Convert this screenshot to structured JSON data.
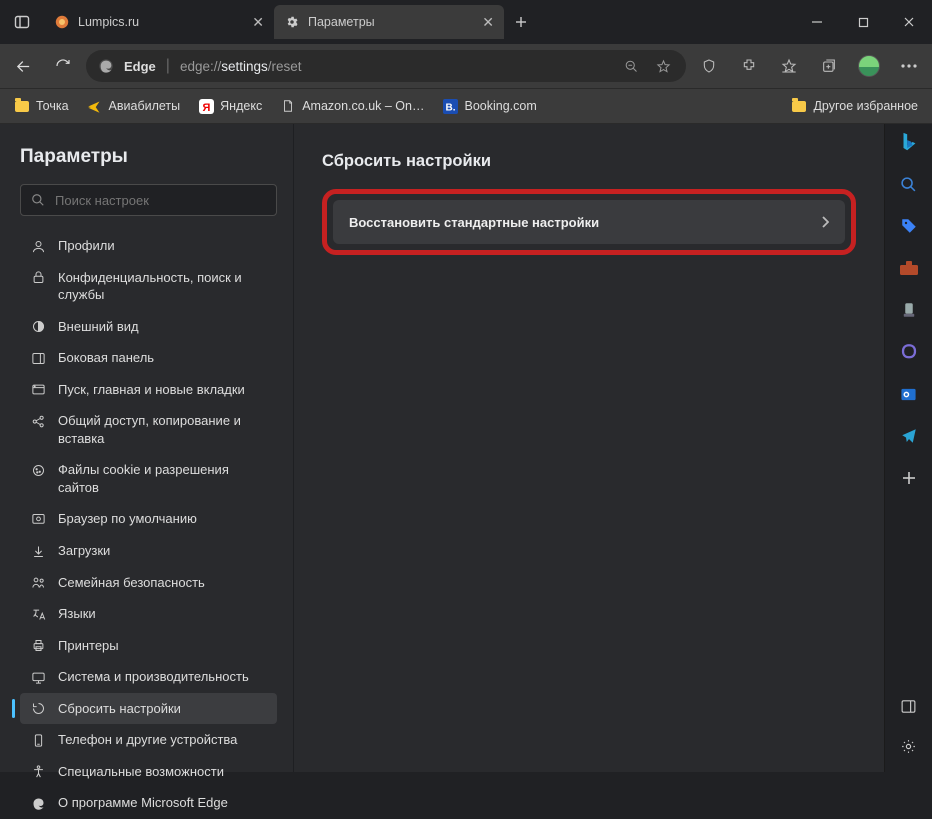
{
  "tabs": [
    {
      "title": "Lumpics.ru",
      "favicon": "circle-orange"
    },
    {
      "title": "Параметры",
      "favicon": "gear"
    }
  ],
  "address": {
    "browser_label": "Edge",
    "url_prefix": "edge://",
    "url_segment": "settings",
    "url_rest": "/reset"
  },
  "bookmarks": {
    "items": [
      {
        "label": "Точка",
        "icon": "folder"
      },
      {
        "label": "Авиабилеты",
        "icon": "plane"
      },
      {
        "label": "Яндекс",
        "icon": "ya"
      },
      {
        "label": "Amazon.co.uk – On…",
        "icon": "page"
      },
      {
        "label": "Booking.com",
        "icon": "booking"
      }
    ],
    "other": "Другое избранное"
  },
  "sidebar": {
    "title": "Параметры",
    "search_placeholder": "Поиск настроек",
    "items": [
      {
        "label": "Профили",
        "icon": "profile"
      },
      {
        "label": "Конфиденциальность, поиск и службы",
        "icon": "lock"
      },
      {
        "label": "Внешний вид",
        "icon": "appearance"
      },
      {
        "label": "Боковая панель",
        "icon": "sidepanel"
      },
      {
        "label": "Пуск, главная и новые вкладки",
        "icon": "home"
      },
      {
        "label": "Общий доступ, копирование и вставка",
        "icon": "share"
      },
      {
        "label": "Файлы cookie и разрешения сайтов",
        "icon": "cookie"
      },
      {
        "label": "Браузер по умолчанию",
        "icon": "default"
      },
      {
        "label": "Загрузки",
        "icon": "download"
      },
      {
        "label": "Семейная безопасность",
        "icon": "family"
      },
      {
        "label": "Языки",
        "icon": "lang"
      },
      {
        "label": "Принтеры",
        "icon": "printer"
      },
      {
        "label": "Система и производительность",
        "icon": "system"
      },
      {
        "label": "Сбросить настройки",
        "icon": "reset",
        "selected": true
      },
      {
        "label": "Телефон и другие устройства",
        "icon": "phone"
      },
      {
        "label": "Специальные возможности",
        "icon": "accessibility"
      },
      {
        "label": "О программе Microsoft Edge",
        "icon": "edge"
      }
    ]
  },
  "main": {
    "heading": "Сбросить настройки",
    "reset_button": "Восстановить стандартные настройки"
  }
}
